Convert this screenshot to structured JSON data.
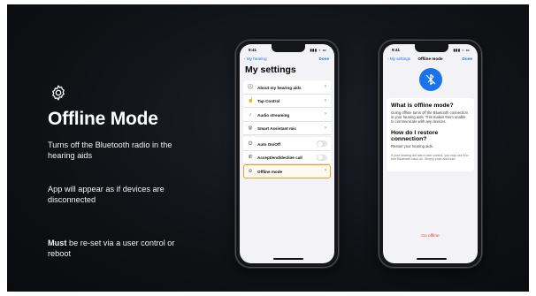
{
  "left": {
    "title": "Offline Mode",
    "line1": "Turns off the Bluetooth radio in the hearing aids",
    "line2": "App will appear as if devices are disconnected",
    "line3_bold": "Must",
    "line3_rest": " be re-set via a user control or reboot"
  },
  "phone1": {
    "time": "9:41",
    "back": "My hearing",
    "done": "Done",
    "title": "My settings",
    "items": [
      {
        "label": "About my hearing aids",
        "icon": "info-icon"
      },
      {
        "label": "Tap Control",
        "icon": "tap-icon"
      },
      {
        "label": "Audio streaming",
        "icon": "audio-icon"
      },
      {
        "label": "Smart Assistant mic",
        "icon": "mic-icon"
      },
      {
        "label": "Auto On/Off",
        "icon": "power-icon"
      },
      {
        "label": "Accept/end/decline call",
        "icon": "phone-icon"
      },
      {
        "label": "Offline mode",
        "icon": "offline-icon"
      }
    ]
  },
  "phone2": {
    "time": "9:41",
    "back": "My settings",
    "title": "Offline mode",
    "done": "Done",
    "q1": "What is offline mode?",
    "a1": "Going offline turns off the Bluetooth connection in your hearing aids. This makes them unable to communicate with any devices.",
    "q2": "How do I restore connection?",
    "a2": "Restart your hearing aids.",
    "a2_small": "If your hearing aid has a user control, you may use it to turn Bluetooth back on. Simply push and hold.",
    "action": "Go offline"
  },
  "colors": {
    "accent": "#1a73e8",
    "highlight": "#f0a020",
    "danger": "#e0443a"
  }
}
